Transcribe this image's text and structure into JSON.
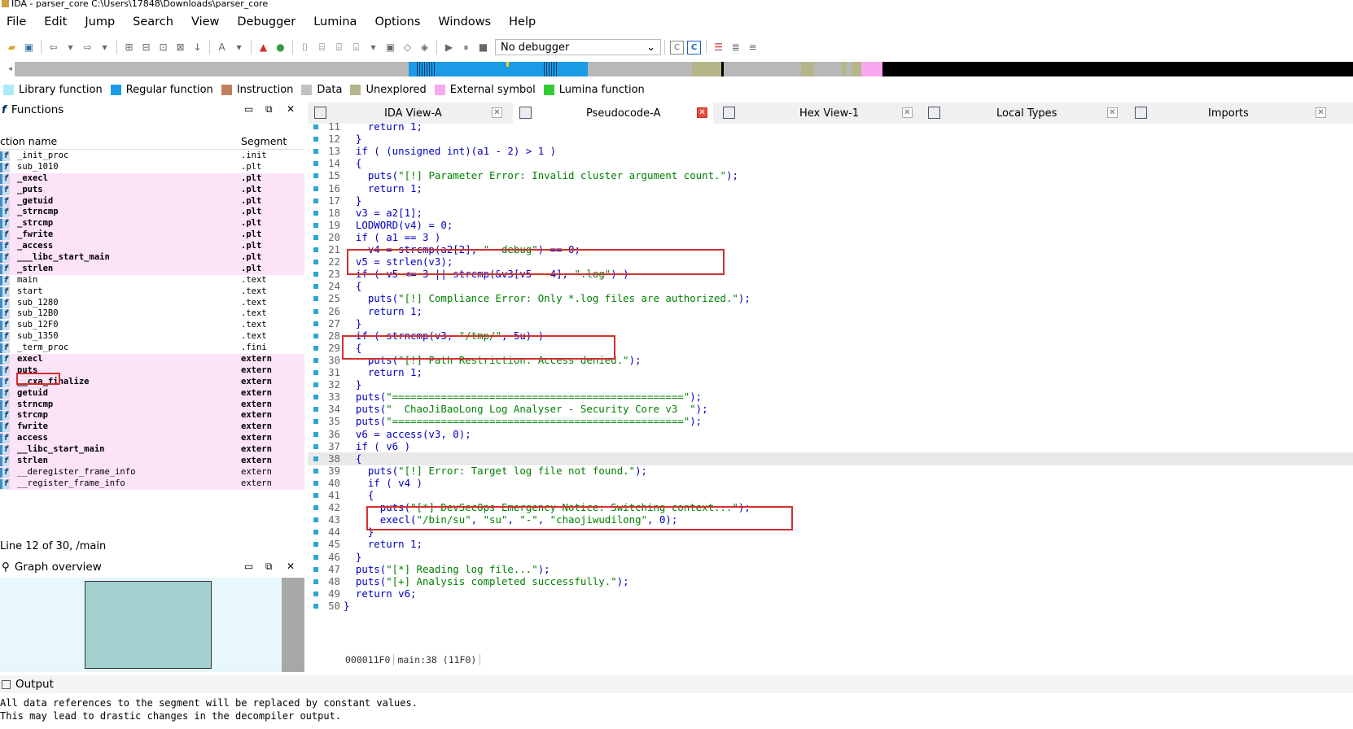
{
  "window": {
    "title": "IDA - parser_core C:\\Users\\17848\\Downloads\\parser_core"
  },
  "menu": [
    "File",
    "Edit",
    "Jump",
    "Search",
    "View",
    "Debugger",
    "Lumina",
    "Options",
    "Windows",
    "Help"
  ],
  "toolbar": {
    "debugger_select": "No debugger"
  },
  "legend": [
    {
      "label": "Library function",
      "color": "#a8ecf7"
    },
    {
      "label": "Regular function",
      "color": "#1a9be6"
    },
    {
      "label": "Instruction",
      "color": "#c08060"
    },
    {
      "label": "Data",
      "color": "#c0c0c0"
    },
    {
      "label": "Unexplored",
      "color": "#b5b58a"
    },
    {
      "label": "External symbol",
      "color": "#f7a8f0"
    },
    {
      "label": "Lumina function",
      "color": "#33cc33"
    }
  ],
  "functions": {
    "title": "Functions",
    "col_name": "ction name",
    "col_segment": "Segment",
    "rows": [
      {
        "name": "_init_proc",
        "segment": ".init",
        "bold": false,
        "pink": false
      },
      {
        "name": "sub_1010",
        "segment": ".plt",
        "bold": false,
        "pink": false
      },
      {
        "name": "_execl",
        "segment": ".plt",
        "bold": true,
        "pink": true
      },
      {
        "name": "_puts",
        "segment": ".plt",
        "bold": true,
        "pink": true
      },
      {
        "name": "_getuid",
        "segment": ".plt",
        "bold": true,
        "pink": true
      },
      {
        "name": "_strncmp",
        "segment": ".plt",
        "bold": true,
        "pink": true
      },
      {
        "name": "_strcmp",
        "segment": ".plt",
        "bold": true,
        "pink": true
      },
      {
        "name": "_fwrite",
        "segment": ".plt",
        "bold": true,
        "pink": true
      },
      {
        "name": "_access",
        "segment": ".plt",
        "bold": true,
        "pink": true
      },
      {
        "name": "___libc_start_main",
        "segment": ".plt",
        "bold": true,
        "pink": true
      },
      {
        "name": "_strlen",
        "segment": ".plt",
        "bold": true,
        "pink": true
      },
      {
        "name": "main",
        "segment": ".text",
        "bold": false,
        "pink": false
      },
      {
        "name": "start",
        "segment": ".text",
        "bold": false,
        "pink": false
      },
      {
        "name": "sub_1280",
        "segment": ".text",
        "bold": false,
        "pink": false
      },
      {
        "name": "sub_12B0",
        "segment": ".text",
        "bold": false,
        "pink": false
      },
      {
        "name": "sub_12F0",
        "segment": ".text",
        "bold": false,
        "pink": false
      },
      {
        "name": "sub_1350",
        "segment": ".text",
        "bold": false,
        "pink": false
      },
      {
        "name": "_term_proc",
        "segment": ".fini",
        "bold": false,
        "pink": false
      },
      {
        "name": "execl",
        "segment": "extern",
        "bold": true,
        "pink": true
      },
      {
        "name": "puts",
        "segment": "extern",
        "bold": true,
        "pink": true
      },
      {
        "name": "__cxa_finalize",
        "segment": "extern",
        "bold": true,
        "pink": true
      },
      {
        "name": "getuid",
        "segment": "extern",
        "bold": true,
        "pink": true
      },
      {
        "name": "strncmp",
        "segment": "extern",
        "bold": true,
        "pink": true
      },
      {
        "name": "strcmp",
        "segment": "extern",
        "bold": true,
        "pink": true
      },
      {
        "name": "fwrite",
        "segment": "extern",
        "bold": true,
        "pink": true
      },
      {
        "name": "access",
        "segment": "extern",
        "bold": true,
        "pink": true
      },
      {
        "name": "__libc_start_main",
        "segment": "extern",
        "bold": true,
        "pink": true
      },
      {
        "name": "strlen",
        "segment": "extern",
        "bold": true,
        "pink": true
      },
      {
        "name": "__deregister_frame_info",
        "segment": "extern",
        "bold": false,
        "pink": true
      },
      {
        "name": "__register_frame_info",
        "segment": "extern",
        "bold": false,
        "pink": true
      }
    ],
    "status": "Line 12 of 30, /main"
  },
  "graph": {
    "title": "Graph overview"
  },
  "tabs": [
    {
      "label": "IDA View-A",
      "active": false
    },
    {
      "label": "Pseudocode-A",
      "active": true
    },
    {
      "label": "Hex View-1",
      "active": false
    },
    {
      "label": "Local Types",
      "active": false
    },
    {
      "label": "Imports",
      "active": false
    }
  ],
  "code": {
    "lines": [
      {
        "n": "11",
        "t": "    return 1;"
      },
      {
        "n": "12",
        "t": "  }"
      },
      {
        "n": "13",
        "t": "  if ( (unsigned int)(a1 - 2) > 1 )"
      },
      {
        "n": "14",
        "t": "  {"
      },
      {
        "n": "15",
        "t": "    puts(\"[!] Parameter Error: Invalid cluster argument count.\");"
      },
      {
        "n": "16",
        "t": "    return 1;"
      },
      {
        "n": "17",
        "t": "  }"
      },
      {
        "n": "18",
        "t": "  v3 = a2[1];"
      },
      {
        "n": "19",
        "t": "  LODWORD(v4) = 0;"
      },
      {
        "n": "20",
        "t": "  if ( a1 == 3 )"
      },
      {
        "n": "21",
        "t": "    v4 = strcmp(a2[2], \"--debug\") == 0;"
      },
      {
        "n": "22",
        "t": "  v5 = strlen(v3);"
      },
      {
        "n": "23",
        "t": "  if ( v5 <= 3 || strcmp(&v3[v5 - 4], \".log\") )"
      },
      {
        "n": "24",
        "t": "  {"
      },
      {
        "n": "25",
        "t": "    puts(\"[!] Compliance Error: Only *.log files are authorized.\");"
      },
      {
        "n": "26",
        "t": "    return 1;"
      },
      {
        "n": "27",
        "t": "  }"
      },
      {
        "n": "28",
        "t": "  if ( strncmp(v3, \"/tmp/\", 5u) )"
      },
      {
        "n": "29",
        "t": "  {"
      },
      {
        "n": "30",
        "t": "    puts(\"[!] Path Restriction: Access denied.\");"
      },
      {
        "n": "31",
        "t": "    return 1;"
      },
      {
        "n": "32",
        "t": "  }"
      },
      {
        "n": "33",
        "t": "  puts(\"================================================\");"
      },
      {
        "n": "34",
        "t": "  puts(\"  ChaoJiBaoLong Log Analyser - Security Core v3  \");"
      },
      {
        "n": "35",
        "t": "  puts(\"================================================\");"
      },
      {
        "n": "36",
        "t": "  v6 = access(v3, 0);"
      },
      {
        "n": "37",
        "t": "  if ( v6 )"
      },
      {
        "n": "38",
        "t": "  {"
      },
      {
        "n": "39",
        "t": "    puts(\"[!] Error: Target log file not found.\");"
      },
      {
        "n": "40",
        "t": "    if ( v4 )"
      },
      {
        "n": "41",
        "t": "    {"
      },
      {
        "n": "42",
        "t": "      puts(\"[*] DevSecOps Emergency Notice: Switching context...\");"
      },
      {
        "n": "43",
        "t": "      execl(\"/bin/su\", \"su\", \"-\", \"chaojiwudilong\", 0);"
      },
      {
        "n": "44",
        "t": "    }"
      },
      {
        "n": "45",
        "t": "    return 1;"
      },
      {
        "n": "46",
        "t": "  }"
      },
      {
        "n": "47",
        "t": "  puts(\"[*] Reading log file...\");"
      },
      {
        "n": "48",
        "t": "  puts(\"[+] Analysis completed successfully.\");"
      },
      {
        "n": "49",
        "t": "  return v6;"
      },
      {
        "n": "50",
        "t": "}"
      }
    ],
    "status": [
      "000011F0",
      "main:38 (11F0)"
    ]
  },
  "output": {
    "title": "Output",
    "lines": [
      "All data references to the segment will be replaced by constant values.",
      "This may lead to drastic changes in the decompiler output."
    ]
  }
}
